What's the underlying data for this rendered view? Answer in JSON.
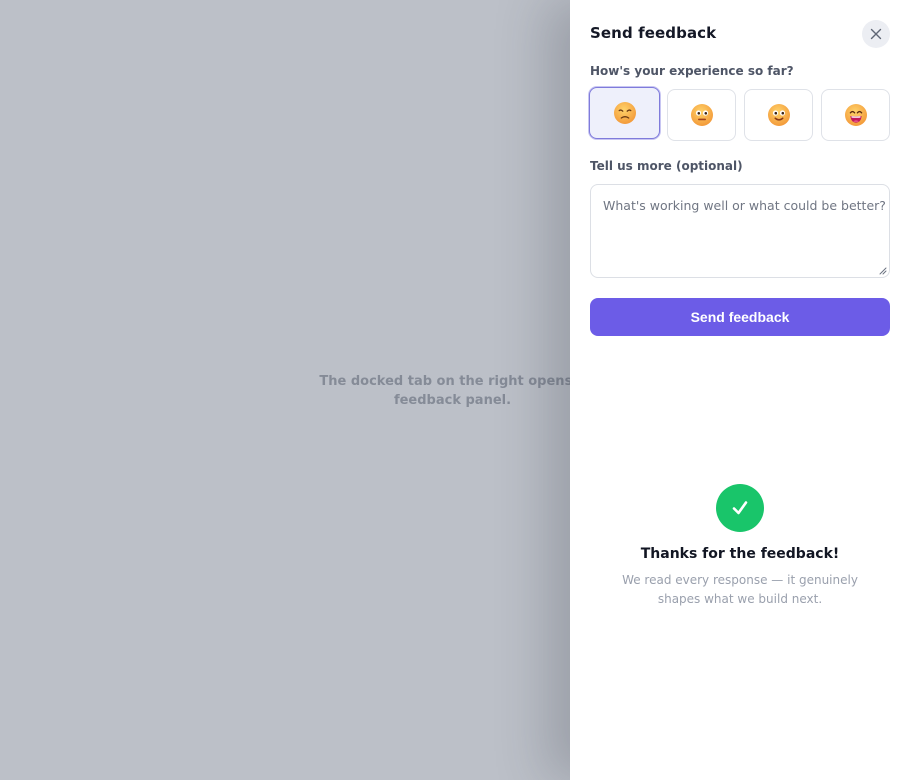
{
  "background": {
    "message": "The docked tab on the right opens a feedback panel."
  },
  "panel": {
    "title": "Send feedback",
    "question": "How's your experience so far?",
    "moods": [
      {
        "icon": "frustrated-face-icon",
        "selected": true
      },
      {
        "icon": "neutral-face-icon",
        "selected": false
      },
      {
        "icon": "smiling-face-icon",
        "selected": false
      },
      {
        "icon": "grinning-face-icon",
        "selected": false
      }
    ],
    "comment": {
      "label": "Tell us more (optional)",
      "placeholder": "What's working well or what could be better?",
      "value": ""
    },
    "submit_label": "Send feedback",
    "success": {
      "title": "Thanks for the feedback!",
      "message": "We read every response — it genuinely shapes what we build next."
    }
  },
  "colors": {
    "accent": "#6c5ce7",
    "success": "#19c56a",
    "backdrop": "#bcc0c8",
    "selected_mood_border": "#7f7bdb"
  }
}
